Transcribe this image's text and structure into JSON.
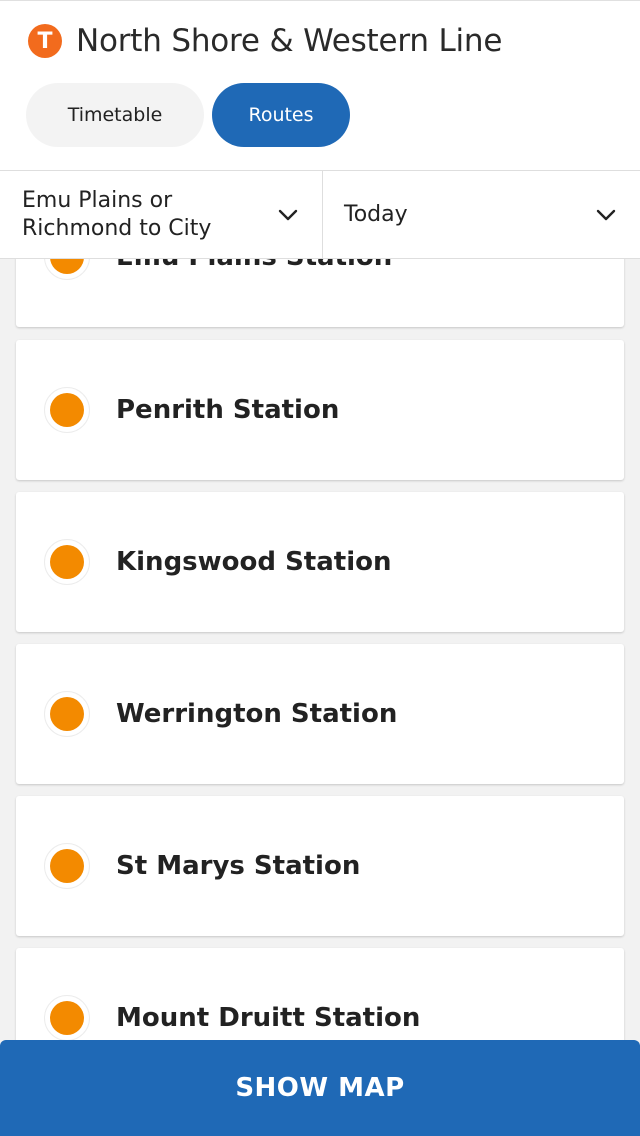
{
  "header": {
    "logo_letter": "T",
    "title": "North Shore & Western Line",
    "tabs": [
      {
        "label": "Timetable",
        "active": false
      },
      {
        "label": "Routes",
        "active": true
      }
    ]
  },
  "filters": {
    "route": "Emu Plains or Richmond to City",
    "day": "Today"
  },
  "stations": [
    {
      "name": "Emu Plains Station"
    },
    {
      "name": "Penrith Station"
    },
    {
      "name": "Kingswood Station"
    },
    {
      "name": "Werrington Station"
    },
    {
      "name": "St Marys Station"
    },
    {
      "name": "Mount Druitt Station"
    }
  ],
  "actions": {
    "show_map": "SHOW MAP"
  },
  "colors": {
    "brand_blue": "#1f69b6",
    "line_orange": "#f38a00",
    "logo_orange": "#f26b1d"
  }
}
